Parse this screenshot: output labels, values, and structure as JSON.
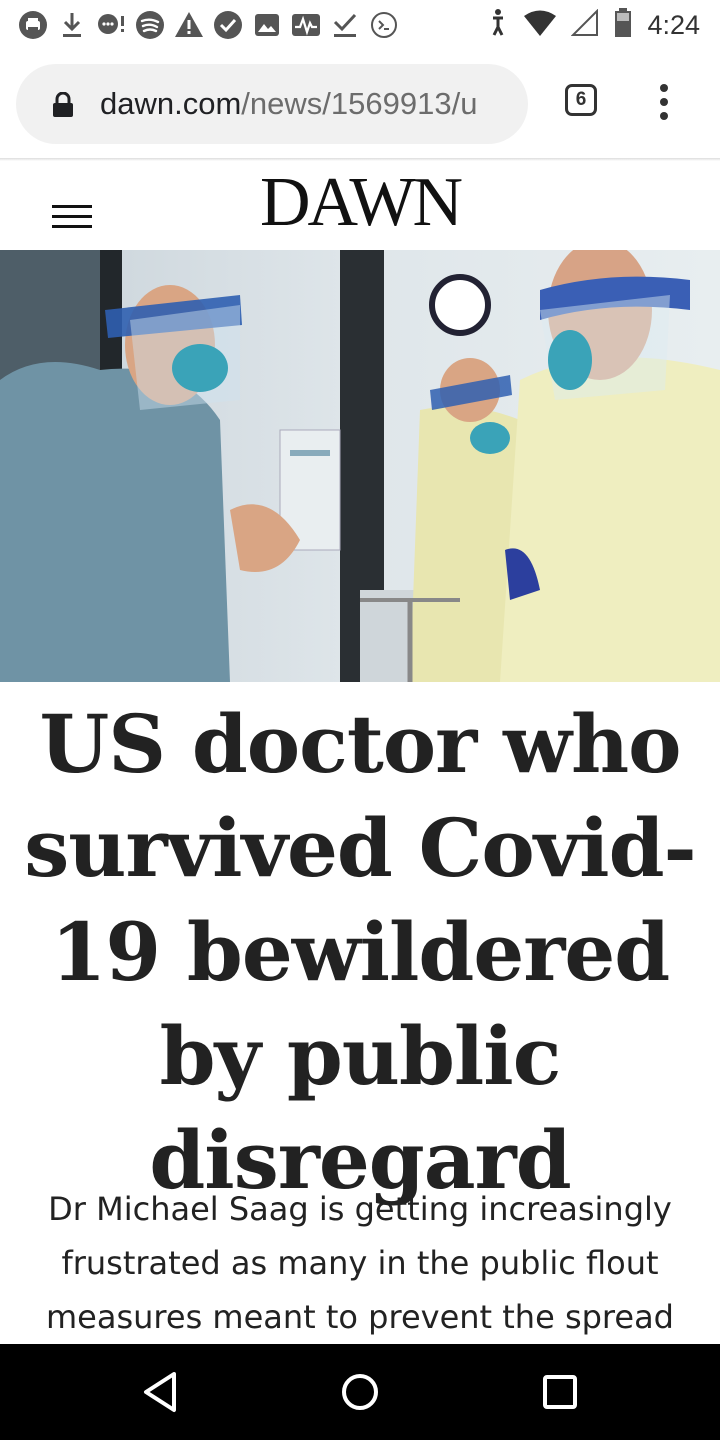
{
  "status_bar": {
    "time": "4:24",
    "left_icons": [
      "printer-icon",
      "download-icon",
      "chat-alert-icon",
      "spotify-icon",
      "warning-icon",
      "check-circle-icon",
      "image-icon",
      "activity-icon",
      "checkmark-icon",
      "terminal-icon"
    ],
    "right_icons": [
      "accessibility-icon",
      "wifi-icon",
      "signal-icon",
      "battery-icon"
    ]
  },
  "browser": {
    "url_domain": "dawn.com",
    "url_path": "/news/1569913/u",
    "tab_count": "6"
  },
  "site": {
    "logo": "DAWN"
  },
  "article": {
    "image_alt": "Doctors in face shields and masks in a hospital ward",
    "headline": "US doctor who survived Covid-19 bewildered by public disregard",
    "summary": "Dr Michael Saag is getting increasingly frustrated as many in the public flout measures meant to prevent the spread"
  },
  "nav_bar": {
    "buttons": [
      "back-icon",
      "home-icon",
      "recent-apps-icon"
    ]
  },
  "colors": {
    "headline": "#222222",
    "url_bar_bg": "#f1f1f1",
    "nav_bar_bg": "#000000"
  }
}
